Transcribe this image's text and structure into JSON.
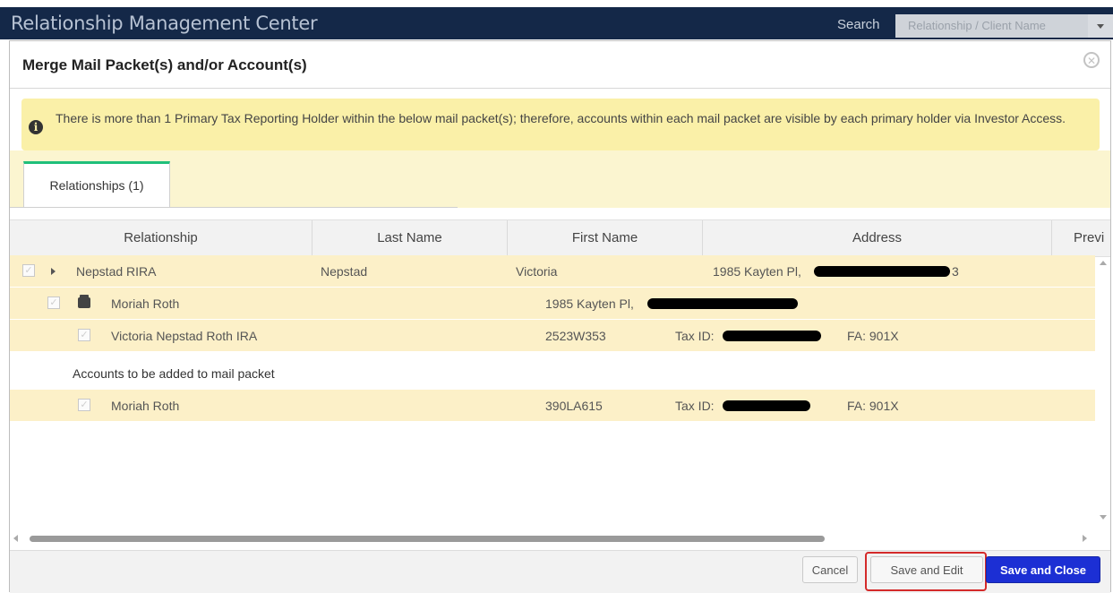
{
  "app": {
    "title": "Relationship Management Center",
    "search_label": "Search",
    "search_placeholder": "Relationship / Client Name"
  },
  "modal": {
    "title": "Merge Mail Packet(s) and/or Account(s)",
    "alert": "There is more than 1 Primary Tax Reporting Holder within the below mail packet(s); therefore, accounts within each mail packet are visible by each primary holder via Investor Access.",
    "tabs": [
      {
        "label": "Relationships (1)"
      }
    ],
    "columns": [
      "Relationship",
      "Last Name",
      "First Name",
      "Address",
      "Previ"
    ],
    "relationship_row": {
      "name": "Nepstad RIRA",
      "last_name": "Nepstad",
      "first_name": "Victoria",
      "address": "1985 Kayten Pl,",
      "address_tail": "3"
    },
    "packet_row": {
      "name": "Moriah Roth",
      "address": "1985 Kayten Pl,"
    },
    "account_row": {
      "name": "Victoria Nepstad Roth IRA",
      "account": "2523W353",
      "tax_label": "Tax ID:",
      "fa": "FA: 901X"
    },
    "section_label": "Accounts to be added to mail packet",
    "added_row": {
      "name": "Moriah Roth",
      "account": "390LA615",
      "tax_label": "Tax ID:",
      "fa": "FA: 901X"
    },
    "buttons": {
      "cancel": "Cancel",
      "save_edit": "Save and Edit",
      "save_close": "Save and Close"
    }
  },
  "colors": {
    "appbar": "#142848",
    "alert_bg": "#faf0a8",
    "row_highlight": "#fcf0c8",
    "tab_accent": "#1fbf7a",
    "primary_button": "#1c2fd4",
    "highlight_outline": "#d42a2a"
  },
  "icons": [
    "info-icon",
    "close-icon",
    "expand-caret-icon",
    "mail-packet-icon",
    "checkbox-icon"
  ]
}
